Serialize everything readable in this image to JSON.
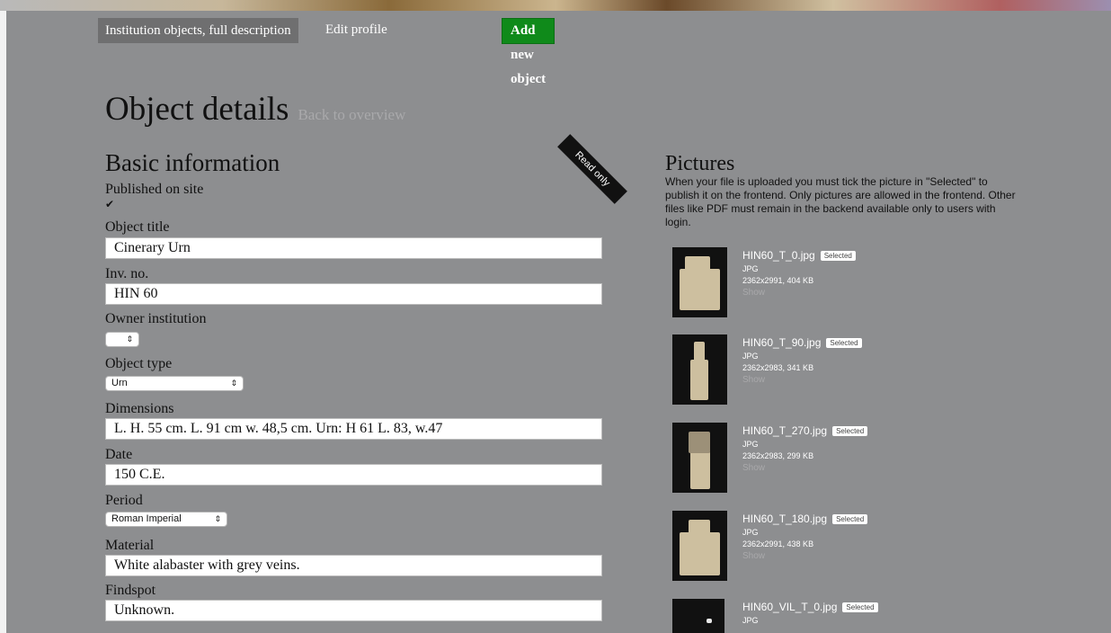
{
  "nav": {
    "tab_active": "Institution objects, full description",
    "tab_edit": "Edit profile",
    "add_button": "Add new object"
  },
  "header": {
    "title": "Object details",
    "back_link": "Back to overview"
  },
  "basic": {
    "title": "Basic information",
    "ribbon": "Read only",
    "published_label": "Published on site",
    "published_checked": true,
    "object_title_label": "Object title",
    "object_title_value": "Cinerary Urn",
    "inv_label": "Inv. no.",
    "inv_value": "HIN 60",
    "owner_label": "Owner institution",
    "owner_value": "",
    "type_label": "Object type",
    "type_value": "Urn",
    "dimensions_label": "Dimensions",
    "dimensions_value": "L. H. 55 cm. L. 91 cm w. 48,5 cm. Urn: H 61 L. 83, w.47",
    "date_label": "Date",
    "date_value": "150 C.E.",
    "period_label": "Period",
    "period_value": "Roman Imperial",
    "material_label": "Material",
    "material_value": "White alabaster with grey veins.",
    "findspot_label": "Findspot",
    "findspot_value": "Unknown."
  },
  "pictures": {
    "title": "Pictures",
    "description": "When your file is uploaded you must tick the picture in \"Selected\" to publish it on the frontend. Only pictures are allowed in the frontend. Other files like PDF must remain in the backend available only to users with login.",
    "items": [
      {
        "name": "HIN60_T_0.jpg",
        "badge": "Selected",
        "format": "JPG",
        "meta": "2362x2991, 404 KB",
        "show": "Show"
      },
      {
        "name": "HIN60_T_90.jpg",
        "badge": "Selected",
        "format": "JPG",
        "meta": "2362x2983, 341 KB",
        "show": "Show"
      },
      {
        "name": "HIN60_T_270.jpg",
        "badge": "Selected",
        "format": "JPG",
        "meta": "2362x2983, 299 KB",
        "show": "Show"
      },
      {
        "name": "HIN60_T_180.jpg",
        "badge": "Selected",
        "format": "JPG",
        "meta": "2362x2991, 438 KB",
        "show": "Show"
      },
      {
        "name": "HIN60_VIL_T_0.jpg",
        "badge": "Selected",
        "format": "JPG",
        "meta": "",
        "show": ""
      }
    ]
  }
}
